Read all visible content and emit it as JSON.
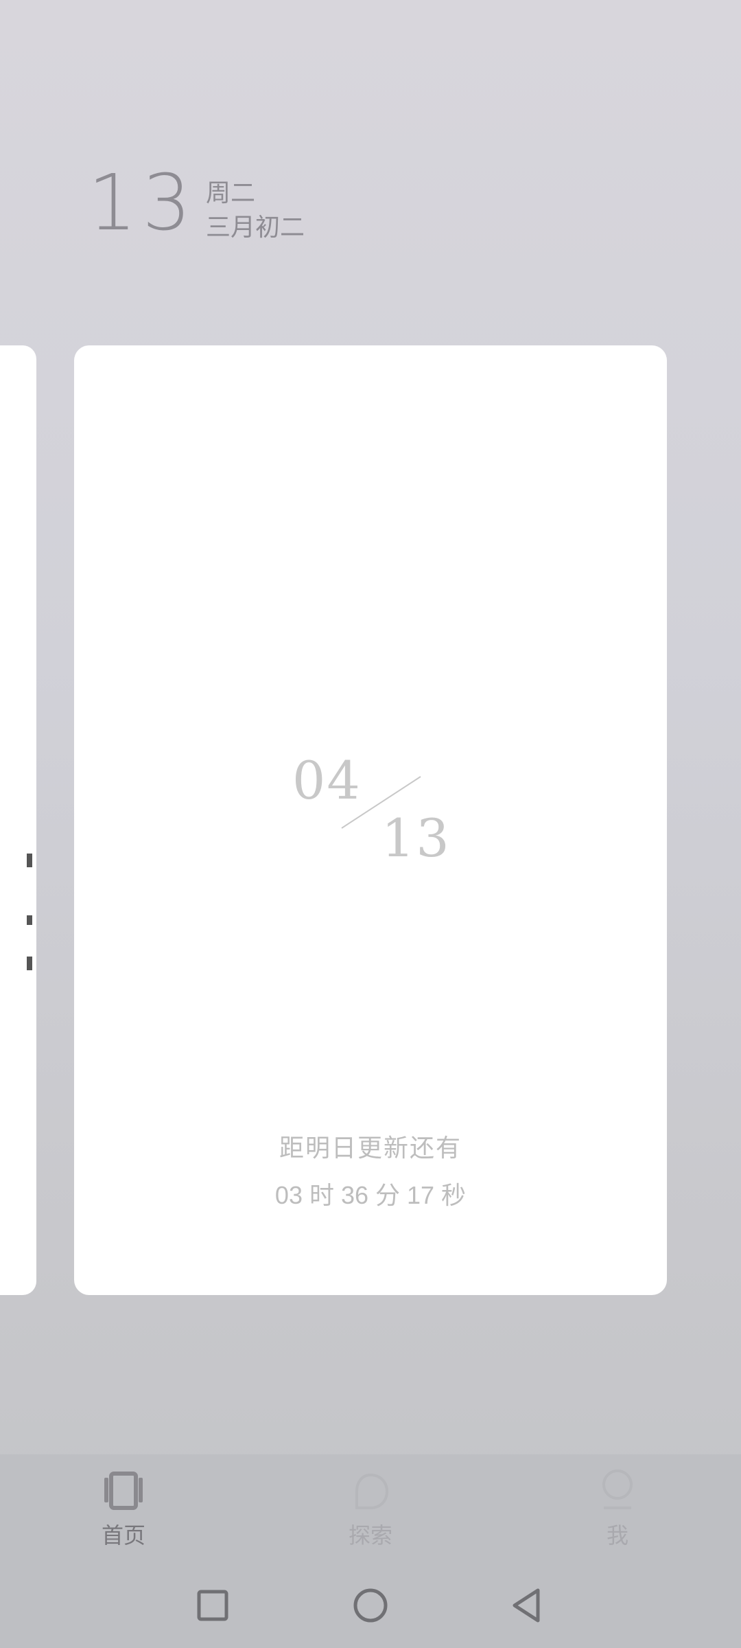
{
  "header": {
    "day": "13",
    "weekday": "周二",
    "lunar_date": "三月初二"
  },
  "card": {
    "month": "04",
    "day": "13",
    "countdown_label": "距明日更新还有",
    "countdown_time": "03 时 36 分 17 秒"
  },
  "bottom_nav": {
    "items": [
      {
        "label": "首页",
        "icon": "home-cards-icon",
        "active": true
      },
      {
        "label": "探索",
        "icon": "explore-chat-icon",
        "active": false
      },
      {
        "label": "我",
        "icon": "profile-icon",
        "active": false
      }
    ]
  },
  "system_nav": {
    "icons": [
      "recents-square-icon",
      "home-circle-icon",
      "back-triangle-icon"
    ]
  },
  "colors": {
    "background_top": "#d8d6dc",
    "background_bottom": "#c2c3c6",
    "card": "#ffffff",
    "header_text": "#8e8c93",
    "card_date_text": "#c8c8c8",
    "countdown_text": "#bdbdbd",
    "nav_active": "#78777c",
    "nav_inactive": "#a9a9ae"
  }
}
